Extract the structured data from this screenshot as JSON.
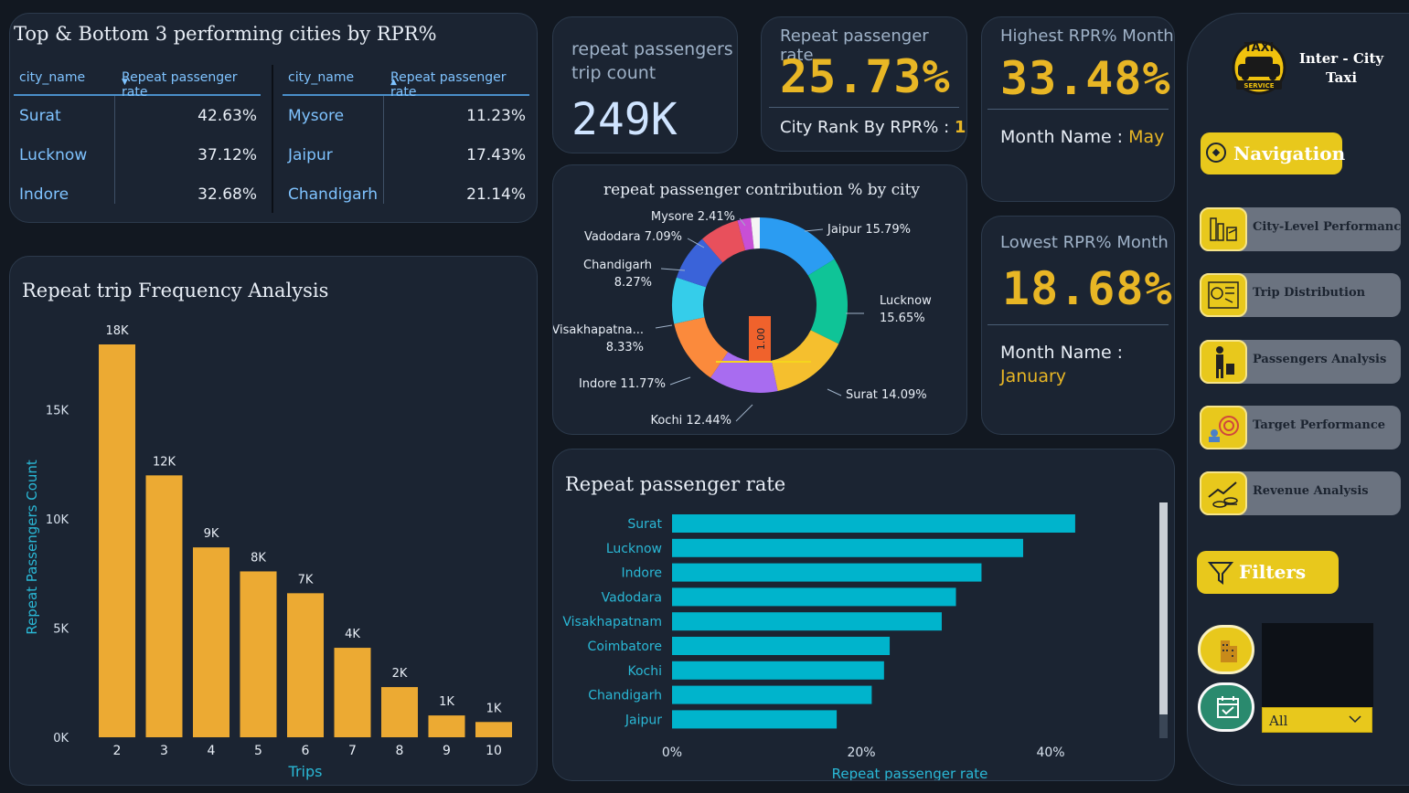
{
  "top_bottom": {
    "title": "Top & Bottom 3 performing cities by RPR%",
    "col_city": "city_name",
    "col_rate": "Repeat passenger rate",
    "top": [
      {
        "city": "Surat",
        "rate": "42.63%"
      },
      {
        "city": "Lucknow",
        "rate": "37.12%"
      },
      {
        "city": "Indore",
        "rate": "32.68%"
      }
    ],
    "bottom": [
      {
        "city": "Mysore",
        "rate": "11.23%"
      },
      {
        "city": "Jaipur",
        "rate": "17.43%"
      },
      {
        "city": "Chandigarh",
        "rate": "21.14%"
      }
    ]
  },
  "kpi_trip_count": {
    "title_line1": "repeat passengers",
    "title_line2": "trip count",
    "value": "249K"
  },
  "kpi_rpr": {
    "title": "Repeat passenger rate",
    "value": "25.73%",
    "rank_label": "City Rank By RPR% :",
    "rank_value": "1"
  },
  "kpi_highest": {
    "title": "Highest RPR% Month",
    "value": "33.48%",
    "month_label": "Month Name :",
    "month_value": "May"
  },
  "kpi_lowest": {
    "title": "Lowest RPR% Month",
    "value": "18.68%",
    "month_label": "Month Name :",
    "month_value": "January"
  },
  "brand": {
    "logo_top": "TAXI",
    "logo_bottom": "SERVICE",
    "line1": "Inter - City",
    "line2": "Taxi"
  },
  "navigation": {
    "title": "Navigation",
    "items": [
      {
        "label": "City-Level Performance",
        "icon": "city-chart-icon"
      },
      {
        "label": "Trip Distribution",
        "icon": "map-chart-icon"
      },
      {
        "label": "Passengers Analysis",
        "icon": "traveler-icon"
      },
      {
        "label": "Target Performance",
        "icon": "target-icon"
      },
      {
        "label": "Revenue Analysis",
        "icon": "revenue-icon"
      }
    ]
  },
  "filters": {
    "title": "Filters",
    "selected": "All"
  },
  "colors": {
    "gold": "#e8b625",
    "bar_teal": "#00b4cc",
    "bar_gold": "#ecaa33"
  },
  "freq_chart": {
    "title": "Repeat trip Frequency Analysis",
    "xlabel": "Trips",
    "ylabel": "Repeat Passengers Count",
    "ytick_labels": [
      "0K",
      "5K",
      "10K",
      "15K"
    ]
  },
  "donut_chart": {
    "title": "repeat passenger contribution % by city",
    "center_label": "1.00"
  },
  "rpr_chart": {
    "title": "Repeat passenger rate",
    "xlabel": "Repeat passenger rate",
    "xtick_labels": [
      "0%",
      "20%",
      "40%"
    ]
  },
  "chart_data": [
    {
      "type": "bar",
      "title": "Repeat trip Frequency Analysis",
      "xlabel": "Trips",
      "ylabel": "Repeat Passengers Count",
      "categories": [
        "2",
        "3",
        "4",
        "5",
        "6",
        "7",
        "8",
        "9",
        "10"
      ],
      "values": [
        18000,
        12000,
        8700,
        7600,
        6600,
        4100,
        2300,
        1000,
        700
      ],
      "labels": [
        "18K",
        "12K",
        "9K",
        "8K",
        "7K",
        "4K",
        "2K",
        "1K",
        "1K"
      ],
      "ylim": [
        0,
        18000
      ],
      "grid": false
    },
    {
      "type": "pie",
      "title": "repeat passenger contribution % by city",
      "slices": [
        {
          "name": "Jaipur",
          "label": "Jaipur 15.79%",
          "value": 15.79,
          "color": "#2b9cf2"
        },
        {
          "name": "Lucknow",
          "label_line1": "Lucknow",
          "label_line2": "15.65%",
          "value": 15.65,
          "color": "#0fc497"
        },
        {
          "name": "Surat",
          "label": "Surat 14.09%",
          "value": 14.09,
          "color": "#f5bf2e"
        },
        {
          "name": "Kochi",
          "label": "Kochi 12.44%",
          "value": 12.44,
          "color": "#a86cf0"
        },
        {
          "name": "Indore",
          "label": "Indore 11.77%",
          "value": 11.77,
          "color": "#fb8a3c"
        },
        {
          "name": "Visakhapatnam",
          "label_line1": "Visakhapatna...",
          "label_line2": "8.33%",
          "value": 8.33,
          "color": "#35cdea"
        },
        {
          "name": "Chandigarh",
          "label_line1": "Chandigarh",
          "label_line2": "8.27%",
          "value": 8.27,
          "color": "#3a63d9"
        },
        {
          "name": "Vadodara",
          "label": "Vadodara 7.09%",
          "value": 7.09,
          "color": "#e8505c"
        },
        {
          "name": "Mysore",
          "label": "Mysore 2.41%",
          "value": 2.41,
          "color": "#c84fd6"
        },
        {
          "name": "Coimbatore",
          "value": 1.6,
          "color": "#f4f4f4"
        }
      ]
    },
    {
      "type": "bar",
      "orientation": "horizontal",
      "title": "Repeat passenger rate",
      "xlabel": "Repeat passenger rate",
      "categories": [
        "Surat",
        "Lucknow",
        "Indore",
        "Vadodara",
        "Visakhapatnam",
        "Coimbatore",
        "Kochi",
        "Chandigarh",
        "Jaipur"
      ],
      "values": [
        42.6,
        37.1,
        32.7,
        30.0,
        28.5,
        23.0,
        22.4,
        21.1,
        17.4
      ],
      "xlim": [
        0,
        50
      ],
      "xtick_labels": [
        "0%",
        "20%",
        "40%"
      ],
      "grid": false
    }
  ]
}
